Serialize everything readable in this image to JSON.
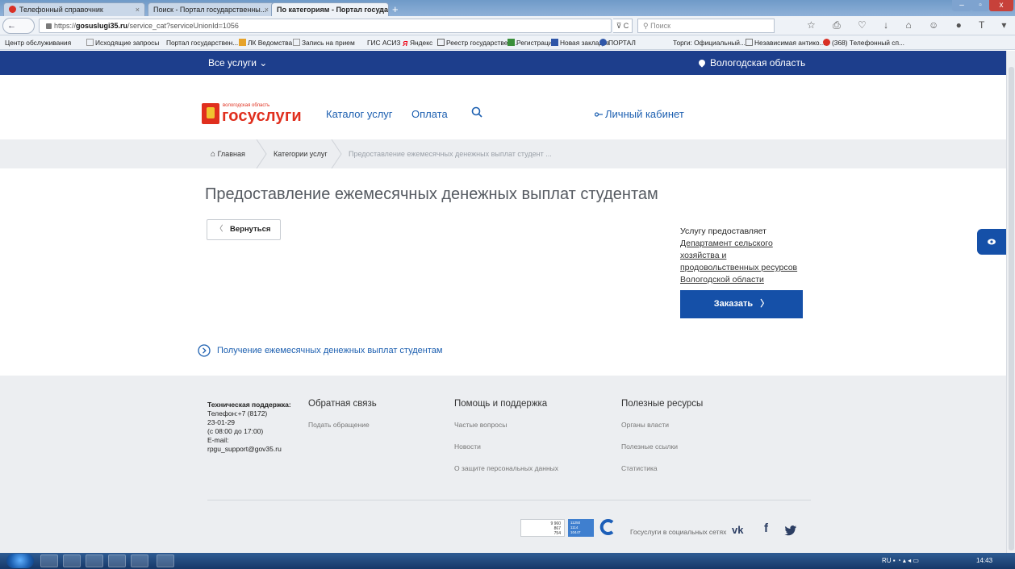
{
  "browser": {
    "tabs": [
      {
        "label": "Телефонный справочник",
        "close": "×"
      },
      {
        "label": "Поиск - Портал государственны...",
        "close": "×"
      },
      {
        "label": "По категориям - Портал госуда...",
        "close": "×"
      }
    ],
    "new_tab": "+",
    "url_prefix": "https://",
    "url_domain": "gosuslugi35.ru",
    "url_path": "/service_cat?serviceUnionId=1056",
    "reload": "⊽ C",
    "search_placeholder": "Поиск",
    "back": "←",
    "bookmarks": [
      "Центр обслуживания",
      "Исходящие запросы",
      "Портал государствен...",
      "ЛК Ведомства",
      "Запись на прием",
      "ГИС АСИЗ",
      "Яндекс",
      "Реестр государствен...",
      "Регистрация",
      "Новая закладка",
      "ПОРТАЛ",
      "Торги: Официальный...",
      "Независимая антико...",
      "(368) Телефонный сп..."
    ]
  },
  "site": {
    "all_services": "Все услуги ⌄",
    "region": "Вологодская область",
    "logo_small": "вологодская область",
    "logo_big": "госуслуги",
    "menu": [
      "Каталог услуг",
      "Оплата"
    ],
    "cabinet": "Личный кабинет",
    "breadcrumbs": [
      "Главная",
      "Категории услуг",
      "Предоставление ежемесячных денежных выплат студент ..."
    ],
    "title": "Предоставление ежемесячных денежных выплат студентам",
    "back_button": "Вернуться",
    "provider_label": "Услугу предоставляет",
    "provider_lines": [
      "Департамент сельского",
      "хозяйства и",
      "продовольственных ресурсов",
      "Вологодской области"
    ],
    "order_button": "Заказать",
    "order_arrow": "〉",
    "sublink": "Получение ежемесячных денежных выплат студентам"
  },
  "footer": {
    "support": [
      "Техническая поддержка:",
      "Телефон:+7 (8172)",
      "23-01-29",
      "(с 08:00 до 17:00)",
      "E-mail:",
      "rpgu_support@gov35.ru"
    ],
    "feedback_head": "Обратная связь",
    "feedback_links": [
      "Подать обращение"
    ],
    "help_head": "Помощь и поддержка",
    "help_links": [
      "Частые вопросы",
      "Новости",
      "О защите персональных данных"
    ],
    "useful_head": "Полезные ресурсы",
    "useful_links": [
      "Органы власти",
      "Полезные ссылки",
      "Статистика"
    ],
    "counter1": [
      "9 960",
      "867",
      "754"
    ],
    "counter2": [
      "11250",
      "1114",
      "10447"
    ],
    "social_label": "Госуслуги в социальных сетях",
    "social": [
      "vk",
      "f"
    ]
  },
  "taskbar": {
    "lang": "RU",
    "time": "14:43"
  }
}
